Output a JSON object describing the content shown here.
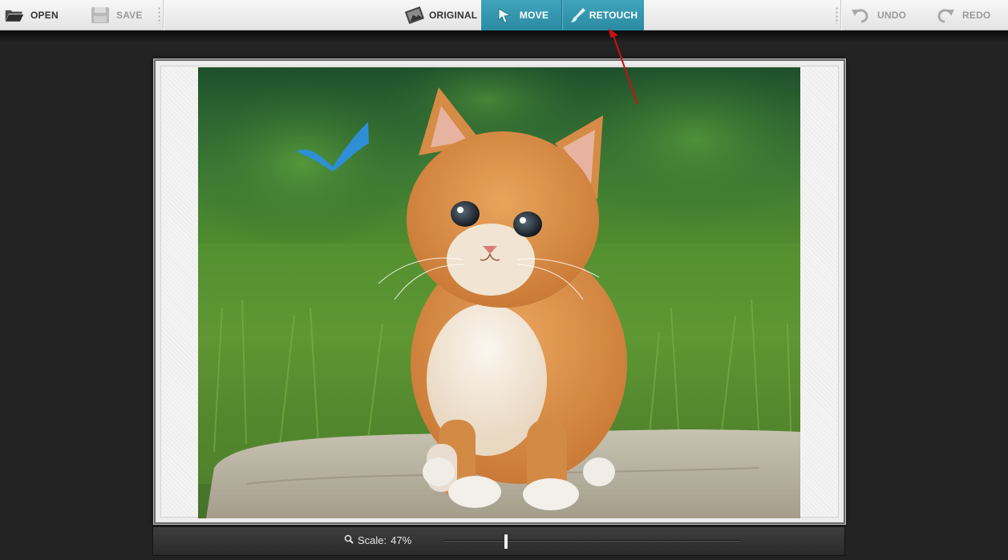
{
  "toolbar": {
    "open_label": "OPEN",
    "save_label": "SAVE",
    "original_label": "ORIGINAL",
    "move_label": "MOVE",
    "retouch_label": "RETOUCH",
    "undo_label": "UNDO",
    "redo_label": "REDO",
    "active_tab": "MOVE",
    "accent_color": "#2f93ab"
  },
  "icons": {
    "open": "folder-open-icon",
    "save": "floppy-disk-icon",
    "original": "photo-icon",
    "move": "cursor-arrow-icon",
    "retouch": "brush-icon",
    "undo": "undo-arrow-icon",
    "redo": "redo-arrow-icon",
    "zoom": "magnifier-icon"
  },
  "canvas": {
    "image_subject": "orange kitten on a rock with grass background",
    "overlay_mark": "checkmark",
    "overlay_color": "#2e8fd6",
    "annotation_arrow_color": "#cc1111"
  },
  "scale": {
    "label": "Scale:",
    "value": "47%",
    "fraction": 0.21
  }
}
